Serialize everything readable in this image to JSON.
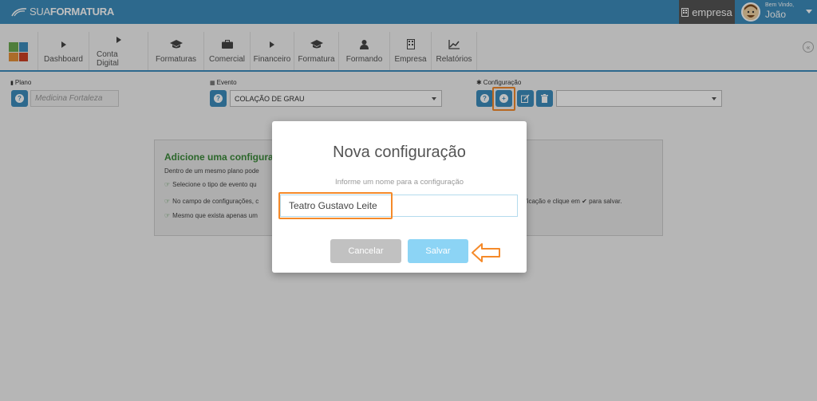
{
  "header": {
    "logo_text_light": "SUA",
    "logo_text_bold": "FORMATURA",
    "empresa_label": "empresa",
    "welcome": "Bem Vindo,",
    "user_name": "João",
    "bar_color": "#3c8dbc"
  },
  "nav": {
    "items": [
      {
        "label": "Dashboard",
        "icon": "caret-right-icon"
      },
      {
        "label": "Conta Digital",
        "icon": "caret-right-icon"
      },
      {
        "label": "Formaturas",
        "icon": "graduation-cap-icon"
      },
      {
        "label": "Comercial",
        "icon": "briefcase-icon"
      },
      {
        "label": "Financeiro",
        "icon": "caret-right-icon"
      },
      {
        "label": "Formatura",
        "icon": "graduation-cap-icon"
      },
      {
        "label": "Formando",
        "icon": "user-icon"
      },
      {
        "label": "Empresa",
        "icon": "building-icon"
      },
      {
        "label": "Relatórios",
        "icon": "chart-icon"
      }
    ]
  },
  "filters": {
    "plano_label": "Plano",
    "plano_value": "Medicina Fortaleza",
    "evento_label": "Evento",
    "evento_value": "COLAÇÃO DE GRAU",
    "config_label": "Configuração",
    "config_value": ""
  },
  "info_panel": {
    "title": "Adicione uma configuraçã",
    "line1": "Dentro de um mesmo plano pode",
    "bullet1": "Selecione o tipo de evento qu",
    "bullet2_left": "No campo de configurações, c",
    "bullet2_right": "ntificação e clique em",
    "bullet2_end": "para salvar.",
    "bullet3": "Mesmo que exista apenas um",
    "line1_right": "."
  },
  "modal": {
    "title": "Nova configuração",
    "subtitle": "Informe um nome para a configuração",
    "input_value": "Teatro Gustavo Leite",
    "cancel_label": "Cancelar",
    "save_label": "Salvar"
  },
  "colors": {
    "accent": "#3c8dbc",
    "highlight": "#f58a2a",
    "save_button": "#8cd4f5",
    "cancel_button": "#c1c1c1"
  }
}
